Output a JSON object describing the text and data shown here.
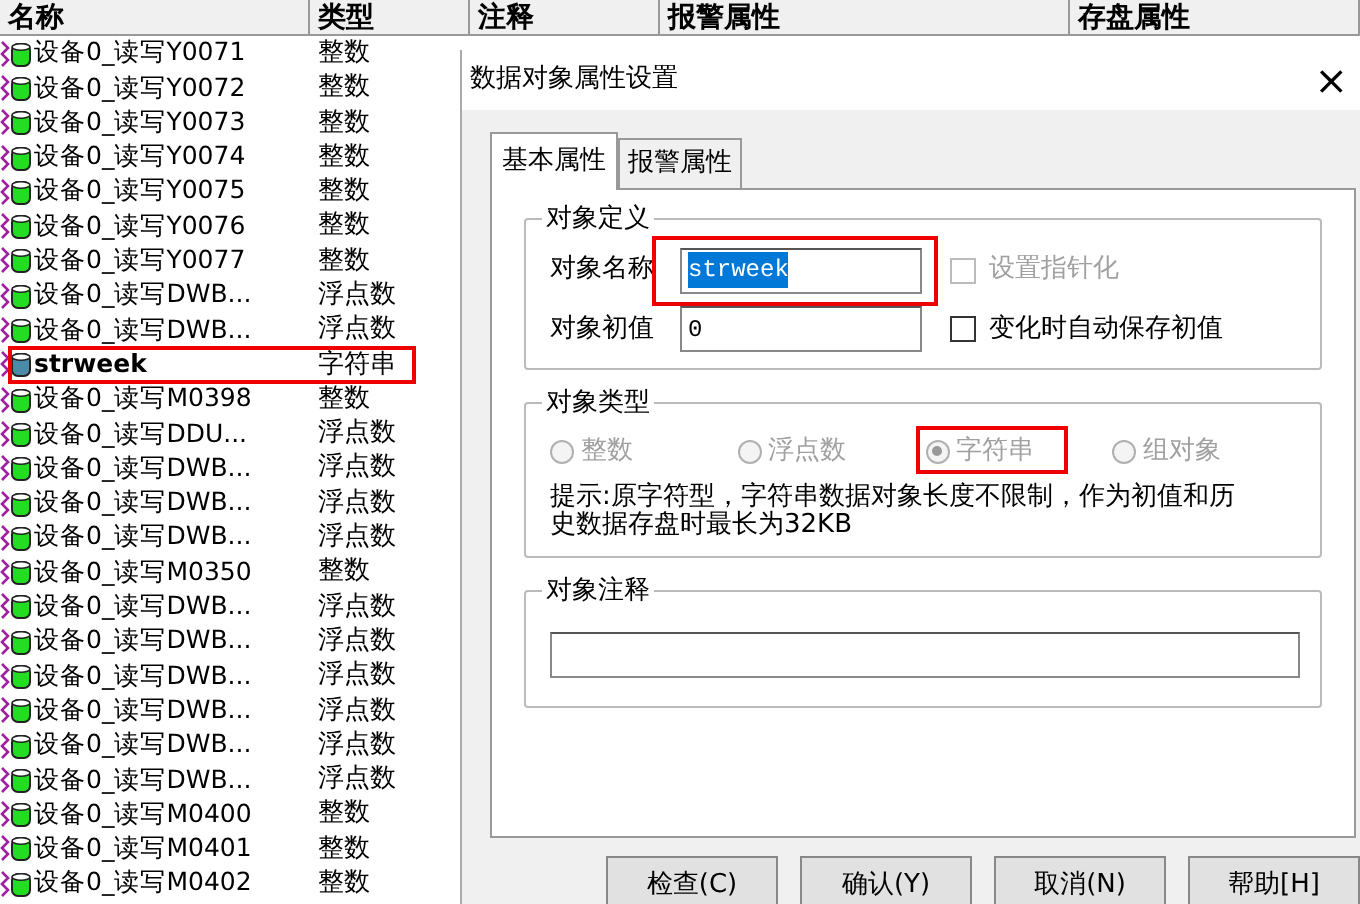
{
  "list": {
    "columns": [
      "名称",
      "类型",
      "注释",
      "报警属性",
      "存盘属性"
    ],
    "rows": [
      {
        "name": "设备0_读写Y0071",
        "type": "整数",
        "color": "#22dd22",
        "highlighted": false
      },
      {
        "name": "设备0_读写Y0072",
        "type": "整数",
        "color": "#22dd22",
        "highlighted": false
      },
      {
        "name": "设备0_读写Y0073",
        "type": "整数",
        "color": "#22dd22",
        "highlighted": false
      },
      {
        "name": "设备0_读写Y0074",
        "type": "整数",
        "color": "#22dd22",
        "highlighted": false
      },
      {
        "name": "设备0_读写Y0075",
        "type": "整数",
        "color": "#22dd22",
        "highlighted": false
      },
      {
        "name": "设备0_读写Y0076",
        "type": "整数",
        "color": "#22dd22",
        "highlighted": false
      },
      {
        "name": "设备0_读写Y0077",
        "type": "整数",
        "color": "#22dd22",
        "highlighted": false
      },
      {
        "name": "设备0_读写DWB...",
        "type": "浮点数",
        "color": "#22dd22",
        "highlighted": false
      },
      {
        "name": "设备0_读写DWB...",
        "type": "浮点数",
        "color": "#22dd22",
        "highlighted": false
      },
      {
        "name": "strweek",
        "type": "字符串",
        "color": "#4a8ca8",
        "highlighted": true
      },
      {
        "name": "设备0_读写M0398",
        "type": "整数",
        "color": "#22dd22",
        "highlighted": false
      },
      {
        "name": "设备0_读写DDU...",
        "type": "浮点数",
        "color": "#22dd22",
        "highlighted": false
      },
      {
        "name": "设备0_读写DWB...",
        "type": "浮点数",
        "color": "#22dd22",
        "highlighted": false
      },
      {
        "name": "设备0_读写DWB...",
        "type": "浮点数",
        "color": "#22dd22",
        "highlighted": false
      },
      {
        "name": "设备0_读写DWB...",
        "type": "浮点数",
        "color": "#22dd22",
        "highlighted": false
      },
      {
        "name": "设备0_读写M0350",
        "type": "整数",
        "color": "#22dd22",
        "highlighted": false
      },
      {
        "name": "设备0_读写DWB...",
        "type": "浮点数",
        "color": "#22dd22",
        "highlighted": false
      },
      {
        "name": "设备0_读写DWB...",
        "type": "浮点数",
        "color": "#22dd22",
        "highlighted": false
      },
      {
        "name": "设备0_读写DWB...",
        "type": "浮点数",
        "color": "#22dd22",
        "highlighted": false
      },
      {
        "name": "设备0_读写DWB...",
        "type": "浮点数",
        "color": "#22dd22",
        "highlighted": false
      },
      {
        "name": "设备0_读写DWB...",
        "type": "浮点数",
        "color": "#22dd22",
        "highlighted": false
      },
      {
        "name": "设备0_读写DWB...",
        "type": "浮点数",
        "color": "#22dd22",
        "highlighted": false
      },
      {
        "name": "设备0_读写M0400",
        "type": "整数",
        "color": "#22dd22",
        "highlighted": false
      },
      {
        "name": "设备0_读写M0401",
        "type": "整数",
        "color": "#22dd22",
        "highlighted": false
      },
      {
        "name": "设备0_读写M0402",
        "type": "整数",
        "color": "#22dd22",
        "highlighted": false
      }
    ]
  },
  "dialog": {
    "title": "数据对象属性设置",
    "close": "×",
    "tabs": [
      {
        "label": "基本属性",
        "selected": true
      },
      {
        "label": "报警属性",
        "selected": false
      }
    ],
    "definition": {
      "legend": "对象定义",
      "name_label": "对象名称",
      "name_value": "strweek",
      "name_text_selected": true,
      "name_highlighted": true,
      "pointer": {
        "label": "设置指针化",
        "checked": false,
        "disabled": true
      },
      "init_label": "对象初值",
      "init_value": "0",
      "autosave": {
        "label": "变化时自动保存初值",
        "checked": false,
        "disabled": false
      }
    },
    "type_group": {
      "legend": "对象类型",
      "options": [
        {
          "label": "整数",
          "selected": false,
          "disabled": true,
          "highlighted": false
        },
        {
          "label": "浮点数",
          "selected": false,
          "disabled": true,
          "highlighted": false
        },
        {
          "label": "字符串",
          "selected": true,
          "disabled": true,
          "highlighted": true
        },
        {
          "label": "组对象",
          "selected": false,
          "disabled": true,
          "highlighted": false
        }
      ],
      "hint": "提示:原字符型，字符串数据对象长度不限制，作为初值和历史数据存盘时最长为32KB"
    },
    "comment": {
      "legend": "对象注释"
    },
    "buttons": [
      "检查(C)",
      "确认(Y)",
      "取消(N)",
      "帮助[H]"
    ]
  }
}
